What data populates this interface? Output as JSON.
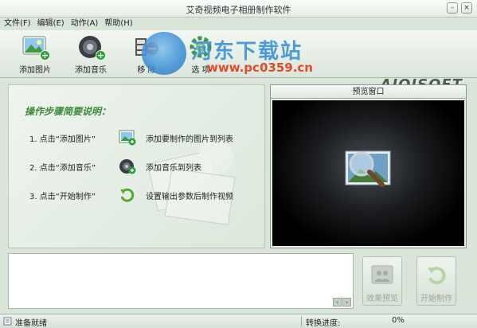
{
  "window": {
    "title": "艾奇视频电子相册制作软件"
  },
  "window_controls": {
    "minimize": "–",
    "close": "×"
  },
  "menu": [
    "文件(F)",
    "编辑(E)",
    "动作(A)",
    "帮助(H)"
  ],
  "toolbar": {
    "add_picture": "添加图片",
    "add_music": "添加音乐",
    "remove": "移  除",
    "options": "选  项"
  },
  "watermark": {
    "title": "河东下载站",
    "url": "www.pc0359.cn"
  },
  "brand": "AIQISOFT",
  "guide": {
    "heading": "操作步骤简要说明：",
    "steps": [
      {
        "num": "1. 点击“添加图片”",
        "desc": "添加要制作的图片到列表"
      },
      {
        "num": "2. 点击“添加音乐”",
        "desc": "添加音乐到列表"
      },
      {
        "num": "3. 点击“开始制作”",
        "desc": "设置输出参数后制作视频"
      }
    ]
  },
  "preview": {
    "title": "预览窗口"
  },
  "buttons": {
    "effect_preview": "效果预览",
    "start_make": "开始制作"
  },
  "status": {
    "text": "准备就绪",
    "progress_label": "转换进度:",
    "progress_value": "0%"
  },
  "colors": {
    "accent_green": "#2f9d3a",
    "watermark_blue": "#3c92d6",
    "watermark_red": "#e04b2b"
  }
}
